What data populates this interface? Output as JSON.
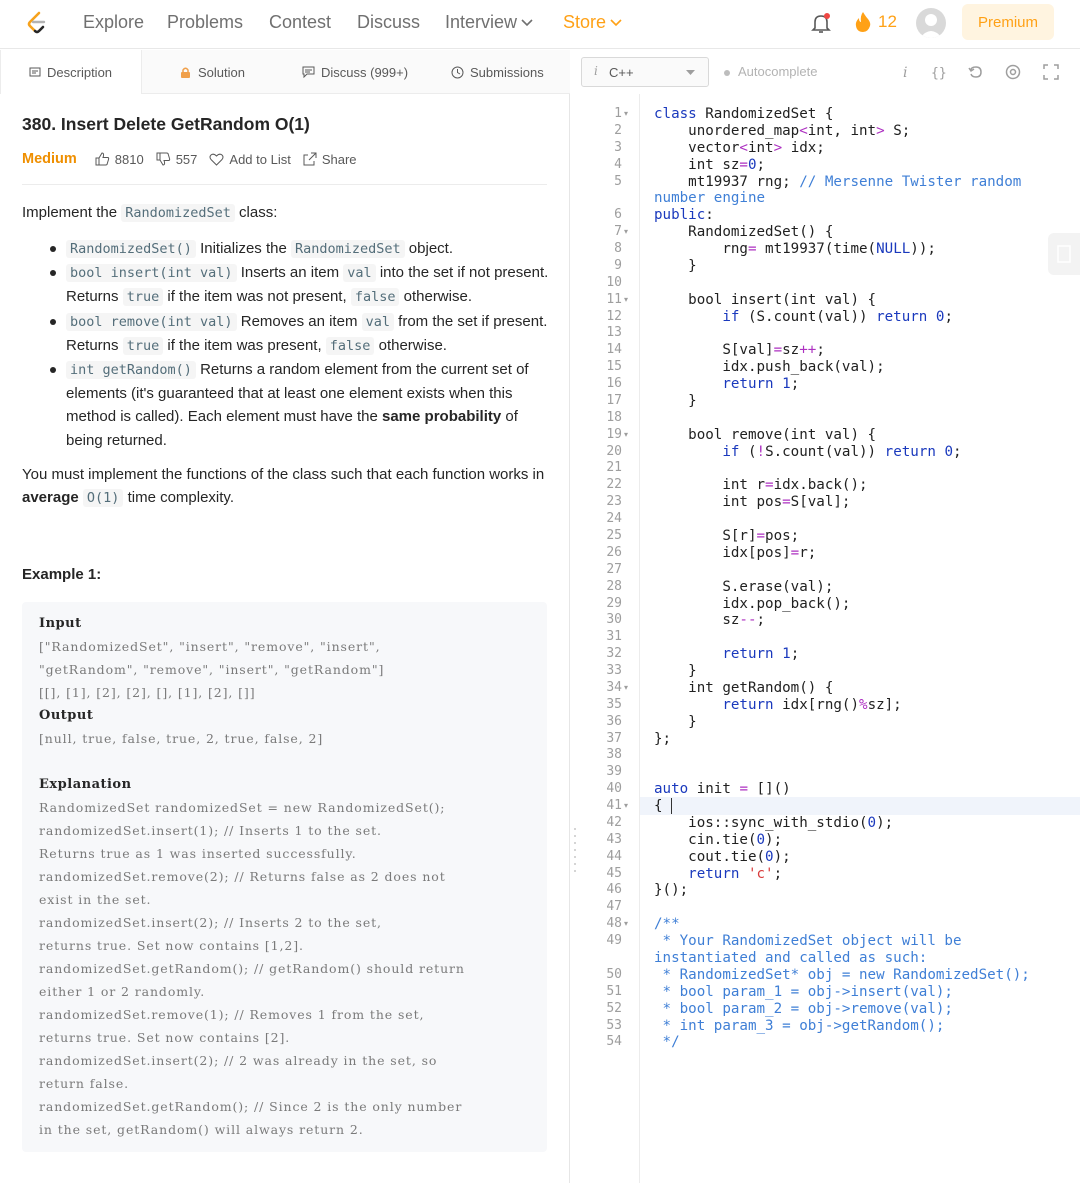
{
  "nav": {
    "items": [
      "Explore",
      "Problems",
      "Contest",
      "Discuss"
    ],
    "interview": "Interview",
    "store": "Store",
    "streak": "12",
    "premium": "Premium"
  },
  "tabs": {
    "description": "Description",
    "solution": "Solution",
    "discuss": "Discuss (999+)",
    "submissions": "Submissions"
  },
  "problem": {
    "title": "380. Insert Delete GetRandom O(1)",
    "difficulty": "Medium",
    "likes": "8810",
    "dislikes": "557",
    "add_to_list": "Add to List",
    "share": "Share",
    "intro_pre": "Implement the ",
    "intro_code": "RandomizedSet",
    "intro_post": " class:",
    "bullets": [
      {
        "code": "RandomizedSet()",
        "t1": " Initializes the ",
        "code2": "RandomizedSet",
        "t2": " object."
      },
      {
        "code": "bool insert(int val)",
        "t1": " Inserts an item ",
        "code2": "val",
        "t2": " into the set if not present. Returns ",
        "code3": "true",
        "t3": " if the item was not present, ",
        "code4": "false",
        "t4": " otherwise."
      },
      {
        "code": "bool remove(int val)",
        "t1": " Removes an item ",
        "code2": "val",
        "t2": " from the set if present. Returns ",
        "code3": "true",
        "t3": " if the item was present, ",
        "code4": "false",
        "t4": " otherwise."
      },
      {
        "code": "int getRandom()",
        "t1": " Returns a random element from the current set of elements (it's guaranteed that at least one element exists when this method is called). Each element must have the ",
        "bold": "same probability",
        "t2": " of being returned."
      }
    ],
    "req_pre": "You must implement the functions of the class such that each function works in ",
    "req_bold": "average",
    "req_code": "O(1)",
    "req_post": " time complexity.",
    "example_title": "Example 1:",
    "example_lines": [
      {
        "text": "Input",
        "head": true
      },
      {
        "text": "[\"RandomizedSet\", \"insert\", \"remove\", \"insert\",",
        "head": false
      },
      {
        "text": "\"getRandom\", \"remove\", \"insert\", \"getRandom\"]",
        "head": false
      },
      {
        "text": "[[], [1], [2], [2], [], [1], [2], []]",
        "head": false
      },
      {
        "text": "Output",
        "head": true
      },
      {
        "text": "[null, true, false, true, 2, true, false, 2]",
        "head": false
      },
      {
        "text": "",
        "head": false
      },
      {
        "text": "Explanation",
        "head": true
      },
      {
        "text": "RandomizedSet randomizedSet = new RandomizedSet();",
        "head": false
      },
      {
        "text": "randomizedSet.insert(1); // Inserts 1 to the set.",
        "head": false
      },
      {
        "text": "Returns true as 1 was inserted successfully.",
        "head": false
      },
      {
        "text": "randomizedSet.remove(2); // Returns false as 2 does not",
        "head": false
      },
      {
        "text": "exist in the set.",
        "head": false
      },
      {
        "text": "randomizedSet.insert(2); // Inserts 2 to the set,",
        "head": false
      },
      {
        "text": "returns true. Set now contains [1,2].",
        "head": false
      },
      {
        "text": "randomizedSet.getRandom(); // getRandom() should return",
        "head": false
      },
      {
        "text": "either 1 or 2 randomly.",
        "head": false
      },
      {
        "text": "randomizedSet.remove(1); // Removes 1 from the set,",
        "head": false
      },
      {
        "text": "returns true. Set now contains [2].",
        "head": false
      },
      {
        "text": "randomizedSet.insert(2); // 2 was already in the set, so",
        "head": false
      },
      {
        "text": "return false.",
        "head": false
      },
      {
        "text": "randomizedSet.getRandom(); // Since 2 is the only number",
        "head": false
      },
      {
        "text": "in the set, getRandom() will always return 2.",
        "head": false
      }
    ]
  },
  "editor": {
    "language": "C++",
    "autocomplete": "Autocomplete",
    "lines": [
      {
        "n": "1",
        "fold": true,
        "parts": [
          [
            "kw",
            "class "
          ],
          [
            "ty",
            "RandomizedSet {"
          ]
        ]
      },
      {
        "n": "2",
        "parts": [
          [
            "ty",
            "    unordered_map"
          ],
          [
            "op",
            "<"
          ],
          [
            "ty",
            "int, int"
          ],
          [
            "op",
            "> "
          ],
          [
            "ty",
            "S;"
          ]
        ]
      },
      {
        "n": "3",
        "parts": [
          [
            "ty",
            "    vector"
          ],
          [
            "op",
            "<"
          ],
          [
            "ty",
            "int"
          ],
          [
            "op",
            "> "
          ],
          [
            "ty",
            "idx;"
          ]
        ]
      },
      {
        "n": "4",
        "parts": [
          [
            "ty",
            "    int sz"
          ],
          [
            "op",
            "="
          ],
          [
            "num",
            "0"
          ],
          [
            "ty",
            ";"
          ]
        ]
      },
      {
        "n": "5",
        "parts": [
          [
            "ty",
            "    mt19937 rng; "
          ],
          [
            "cm",
            "// Mersenne Twister random"
          ]
        ]
      },
      {
        "n": "",
        "parts": [
          [
            "cm",
            "number engine"
          ]
        ]
      },
      {
        "n": "6",
        "parts": [
          [
            "kw",
            "public"
          ],
          [
            "ty",
            ":"
          ]
        ]
      },
      {
        "n": "7",
        "fold": true,
        "parts": [
          [
            "ty",
            "    RandomizedSet() {"
          ]
        ]
      },
      {
        "n": "8",
        "parts": [
          [
            "ty",
            "        rng"
          ],
          [
            "op",
            "="
          ],
          [
            "ty",
            " mt19937(time("
          ],
          [
            "kw",
            "NULL"
          ],
          [
            "ty",
            "));"
          ]
        ]
      },
      {
        "n": "9",
        "parts": [
          [
            "ty",
            "    }"
          ]
        ]
      },
      {
        "n": "10",
        "parts": []
      },
      {
        "n": "11",
        "fold": true,
        "parts": [
          [
            "ty",
            "    bool insert(int val) {"
          ]
        ]
      },
      {
        "n": "12",
        "parts": [
          [
            "ty",
            "        "
          ],
          [
            "kw",
            "if "
          ],
          [
            "ty",
            "(S.count(val)) "
          ],
          [
            "kw",
            "return "
          ],
          [
            "num",
            "0"
          ],
          [
            "ty",
            ";"
          ]
        ]
      },
      {
        "n": "13",
        "parts": []
      },
      {
        "n": "14",
        "parts": [
          [
            "ty",
            "        S[val]"
          ],
          [
            "op",
            "="
          ],
          [
            "ty",
            "sz"
          ],
          [
            "op",
            "++"
          ],
          [
            "ty",
            ";"
          ]
        ]
      },
      {
        "n": "15",
        "parts": [
          [
            "ty",
            "        idx.push_back(val);"
          ]
        ]
      },
      {
        "n": "16",
        "parts": [
          [
            "ty",
            "        "
          ],
          [
            "kw",
            "return "
          ],
          [
            "num",
            "1"
          ],
          [
            "ty",
            ";"
          ]
        ]
      },
      {
        "n": "17",
        "parts": [
          [
            "ty",
            "    }"
          ]
        ]
      },
      {
        "n": "18",
        "parts": []
      },
      {
        "n": "19",
        "fold": true,
        "parts": [
          [
            "ty",
            "    bool remove(int val) {"
          ]
        ]
      },
      {
        "n": "20",
        "parts": [
          [
            "ty",
            "        "
          ],
          [
            "kw",
            "if "
          ],
          [
            "ty",
            "("
          ],
          [
            "op",
            "!"
          ],
          [
            "ty",
            "S.count(val)) "
          ],
          [
            "kw",
            "return "
          ],
          [
            "num",
            "0"
          ],
          [
            "ty",
            ";"
          ]
        ]
      },
      {
        "n": "21",
        "parts": []
      },
      {
        "n": "22",
        "parts": [
          [
            "ty",
            "        int r"
          ],
          [
            "op",
            "="
          ],
          [
            "ty",
            "idx.back();"
          ]
        ]
      },
      {
        "n": "23",
        "parts": [
          [
            "ty",
            "        int pos"
          ],
          [
            "op",
            "="
          ],
          [
            "ty",
            "S[val];"
          ]
        ]
      },
      {
        "n": "24",
        "parts": []
      },
      {
        "n": "25",
        "parts": [
          [
            "ty",
            "        S[r]"
          ],
          [
            "op",
            "="
          ],
          [
            "ty",
            "pos;"
          ]
        ]
      },
      {
        "n": "26",
        "parts": [
          [
            "ty",
            "        idx[pos]"
          ],
          [
            "op",
            "="
          ],
          [
            "ty",
            "r;"
          ]
        ]
      },
      {
        "n": "27",
        "parts": []
      },
      {
        "n": "28",
        "parts": [
          [
            "ty",
            "        S.erase(val);"
          ]
        ]
      },
      {
        "n": "29",
        "parts": [
          [
            "ty",
            "        idx.pop_back();"
          ]
        ]
      },
      {
        "n": "30",
        "parts": [
          [
            "ty",
            "        sz"
          ],
          [
            "op",
            "--"
          ],
          [
            "ty",
            ";"
          ]
        ]
      },
      {
        "n": "31",
        "parts": []
      },
      {
        "n": "32",
        "parts": [
          [
            "ty",
            "        "
          ],
          [
            "kw",
            "return "
          ],
          [
            "num",
            "1"
          ],
          [
            "ty",
            ";"
          ]
        ]
      },
      {
        "n": "33",
        "parts": [
          [
            "ty",
            "    }"
          ]
        ]
      },
      {
        "n": "34",
        "fold": true,
        "parts": [
          [
            "ty",
            "    int getRandom() {"
          ]
        ]
      },
      {
        "n": "35",
        "parts": [
          [
            "ty",
            "        "
          ],
          [
            "kw",
            "return "
          ],
          [
            "ty",
            "idx[rng()"
          ],
          [
            "op",
            "%"
          ],
          [
            "ty",
            "sz];"
          ]
        ]
      },
      {
        "n": "36",
        "parts": [
          [
            "ty",
            "    }"
          ]
        ]
      },
      {
        "n": "37",
        "parts": [
          [
            "ty",
            "};"
          ]
        ]
      },
      {
        "n": "38",
        "parts": []
      },
      {
        "n": "39",
        "parts": []
      },
      {
        "n": "40",
        "parts": [
          [
            "kw",
            "auto "
          ],
          [
            "ty",
            "init "
          ],
          [
            "op",
            "="
          ],
          [
            "ty",
            " []()"
          ]
        ]
      },
      {
        "n": "41",
        "fold": true,
        "active": true,
        "parts": [
          [
            "ty",
            "{ "
          ]
        ]
      },
      {
        "n": "42",
        "parts": [
          [
            "ty",
            "    ios::sync_with_stdio("
          ],
          [
            "num",
            "0"
          ],
          [
            "ty",
            ");"
          ]
        ]
      },
      {
        "n": "43",
        "parts": [
          [
            "ty",
            "    cin.tie("
          ],
          [
            "num",
            "0"
          ],
          [
            "ty",
            ");"
          ]
        ]
      },
      {
        "n": "44",
        "parts": [
          [
            "ty",
            "    cout.tie("
          ],
          [
            "num",
            "0"
          ],
          [
            "ty",
            ");"
          ]
        ]
      },
      {
        "n": "45",
        "parts": [
          [
            "ty",
            "    "
          ],
          [
            "kw",
            "return "
          ],
          [
            "str",
            "'c'"
          ],
          [
            "ty",
            ";"
          ]
        ]
      },
      {
        "n": "46",
        "parts": [
          [
            "ty",
            "}();"
          ]
        ]
      },
      {
        "n": "47",
        "parts": []
      },
      {
        "n": "48",
        "fold": true,
        "parts": [
          [
            "cm",
            "/**"
          ]
        ]
      },
      {
        "n": "49",
        "parts": [
          [
            "cm",
            " * Your RandomizedSet object will be"
          ]
        ]
      },
      {
        "n": "",
        "parts": [
          [
            "cm",
            "instantiated and called as such:"
          ]
        ]
      },
      {
        "n": "50",
        "parts": [
          [
            "cm",
            " * RandomizedSet* obj = new RandomizedSet();"
          ]
        ]
      },
      {
        "n": "51",
        "parts": [
          [
            "cm",
            " * bool param_1 = obj->insert(val);"
          ]
        ]
      },
      {
        "n": "52",
        "parts": [
          [
            "cm",
            " * bool param_2 = obj->remove(val);"
          ]
        ]
      },
      {
        "n": "53",
        "parts": [
          [
            "cm",
            " * int param_3 = obj->getRandom();"
          ]
        ]
      },
      {
        "n": "54",
        "parts": [
          [
            "cm",
            " */"
          ]
        ]
      }
    ]
  },
  "colors": {
    "accent": "#ffa116",
    "keyword": "#1a39bd",
    "comment": "#3f7fd6",
    "operator": "#ad30c1",
    "string": "#d83b3b"
  }
}
